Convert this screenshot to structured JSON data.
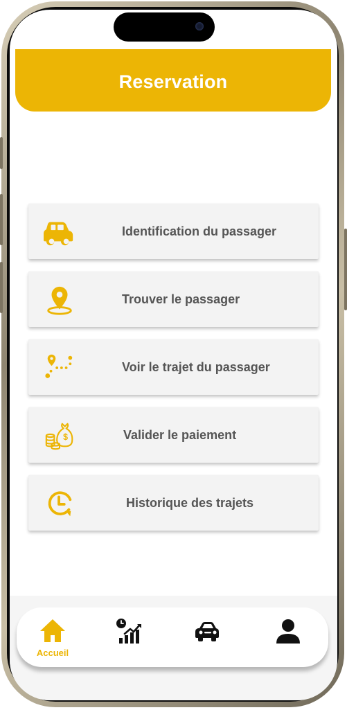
{
  "header": {
    "title": "Reservation"
  },
  "menu": [
    {
      "label": "Identification du passager",
      "icon": "car-icon"
    },
    {
      "label": "Trouver le passager",
      "icon": "location-pin-icon"
    },
    {
      "label": "Voir le trajet du passager",
      "icon": "route-icon"
    },
    {
      "label": "Valider le paiement",
      "icon": "money-bag-icon"
    },
    {
      "label": "Historique des trajets",
      "icon": "history-clock-icon"
    }
  ],
  "bottom_nav": [
    {
      "label": "Accueil",
      "icon": "home-icon",
      "active": true
    },
    {
      "label": "",
      "icon": "stats-chart-icon",
      "active": false
    },
    {
      "label": "",
      "icon": "car-icon",
      "active": false
    },
    {
      "label": "",
      "icon": "user-icon",
      "active": false
    }
  ],
  "colors": {
    "accent": "#ECB505",
    "text": "#555555",
    "card": "#f3f3f3"
  }
}
